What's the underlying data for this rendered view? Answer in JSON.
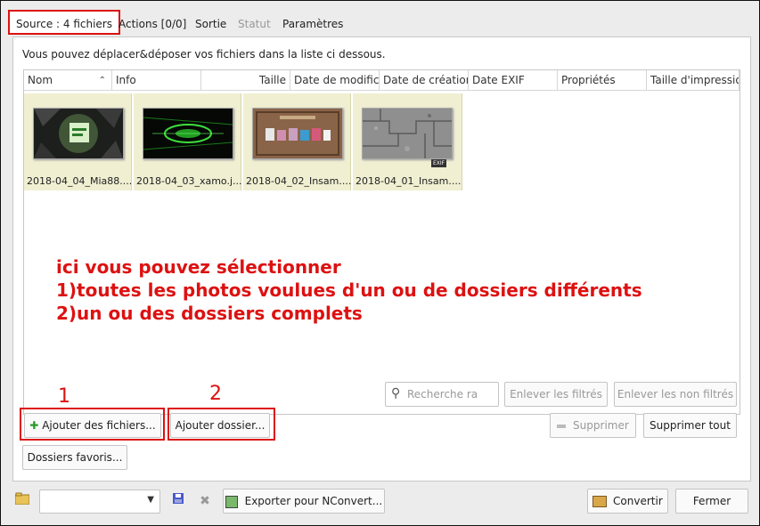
{
  "tabs": [
    {
      "label": "Source : 4 fichiers",
      "state": "active"
    },
    {
      "label": "Actions [0/0]",
      "state": "normal"
    },
    {
      "label": "Sortie",
      "state": "normal"
    },
    {
      "label": "Statut",
      "state": "disabled"
    },
    {
      "label": "Paramètres",
      "state": "normal"
    }
  ],
  "hint_text": "Vous pouvez déplacer&déposer vos fichiers dans la liste ci dessous.",
  "columns": [
    "Nom",
    "Info",
    "Taille",
    "Date de modifica",
    "Date de création",
    "Date EXIF",
    "Propriétés",
    "Taille d'impressio"
  ],
  "files": [
    {
      "name": "2018-04_04_Mia88....",
      "icon": "green-glow-image"
    },
    {
      "name": "2018-04_03_xamo.j...",
      "icon": "green-neon-image"
    },
    {
      "name": "2018-04_02_Insam....",
      "icon": "laurent-text-image",
      "exif": ""
    },
    {
      "name": "2018-04_01_Insam....",
      "icon": "gray-stone-image",
      "exif": "EXIF"
    }
  ],
  "annotation_lines": [
    "ici vous pouvez sélectionner",
    "1)toutes les photos voulues d'un ou de dossiers différents",
    "2)un ou des dossiers complets"
  ],
  "markers": {
    "one": "1",
    "two": "2"
  },
  "buttons": {
    "add_files": "Ajouter des fichiers...",
    "add_folder": "Ajouter dossier...",
    "favorites": "Dossiers favoris...",
    "search_placeholder": "Recherche ra",
    "remove_filtered": "Enlever les filtrés",
    "remove_unfiltered": "Enlever les non filtrés",
    "delete": "Supprimer",
    "delete_all": "Supprimer tout",
    "export": "Exporter pour NConvert...",
    "convert": "Convertir",
    "close": "Fermer"
  },
  "colors": {
    "accent_red": "#dd1111",
    "selected_bg": "#f0efd2"
  }
}
